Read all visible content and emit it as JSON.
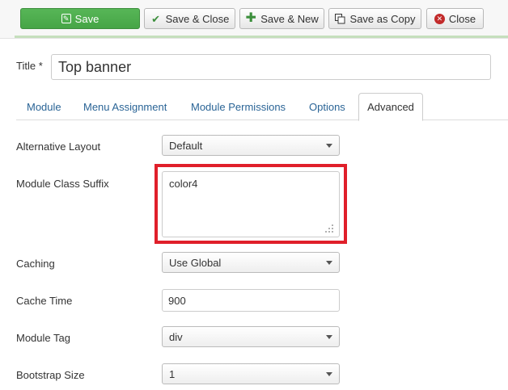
{
  "toolbar": {
    "save_label": "Save",
    "save_close_label": "Save & Close",
    "save_new_label": "Save & New",
    "save_copy_label": "Save as Copy",
    "close_label": "Close",
    "accent_green": "#46a546",
    "close_icon_color": "#c22a2a"
  },
  "title": {
    "label": "Title *",
    "value": "Top banner"
  },
  "tabs": [
    {
      "label": "Module",
      "active": false
    },
    {
      "label": "Menu Assignment",
      "active": false
    },
    {
      "label": "Module Permissions",
      "active": false
    },
    {
      "label": "Options",
      "active": false
    },
    {
      "label": "Advanced",
      "active": true
    }
  ],
  "fields": {
    "alternative_layout": {
      "label": "Alternative Layout",
      "value": "Default"
    },
    "module_class_suffix": {
      "label": "Module Class Suffix",
      "value": "color4",
      "highlighted": true,
      "highlight_color": "#e01f2a"
    },
    "caching": {
      "label": "Caching",
      "value": "Use Global"
    },
    "cache_time": {
      "label": "Cache Time",
      "value": "900"
    },
    "module_tag": {
      "label": "Module Tag",
      "value": "div"
    },
    "bootstrap_size": {
      "label": "Bootstrap Size",
      "value": "1"
    }
  }
}
